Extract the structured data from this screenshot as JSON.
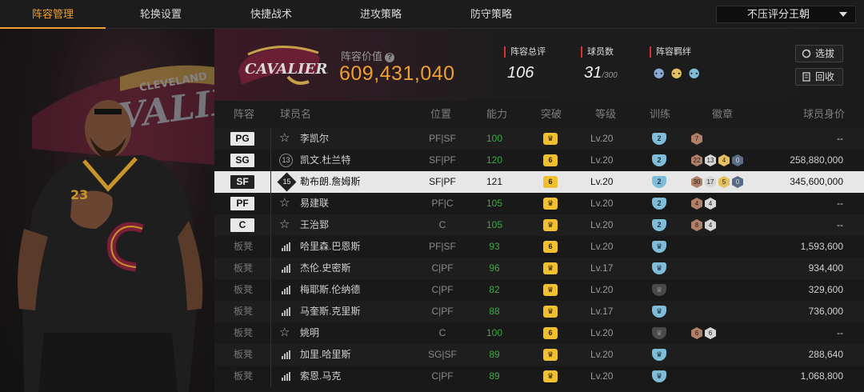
{
  "nav": {
    "tabs": [
      "阵容管理",
      "轮换设置",
      "快捷战术",
      "进攻策略",
      "防守策略"
    ],
    "active_tab": 0,
    "season_select": "不压评分王朝"
  },
  "header": {
    "team_logo_text": "CAVALIERS",
    "value_label": "阵容价值",
    "value": "609,431,040",
    "overall_label": "阵容总评",
    "overall": "106",
    "players_label": "球员数",
    "players_count": "31",
    "players_max": "/300",
    "bonds_label": "阵容羁绊",
    "select_button": "选拔",
    "recycle_button": "回收"
  },
  "columns": [
    "阵容",
    "球员名",
    "位置",
    "能力",
    "突破",
    "等级",
    "训练",
    "徽章",
    "球员身价"
  ],
  "rows": [
    {
      "slot": "PG",
      "starter": true,
      "icon": "star",
      "jersey": "",
      "name": "李凯尔",
      "position": "PF|SF",
      "ability": "100",
      "break": "",
      "level": "Lv.20",
      "train": "2",
      "train_dim": false,
      "badges": [
        {
          "t": "b-bronze",
          "v": "7"
        }
      ],
      "price": "--"
    },
    {
      "slot": "SG",
      "starter": true,
      "icon": "jersey",
      "jersey": "13",
      "name": "凯文.杜兰特",
      "position": "SF|PF",
      "ability": "120",
      "break": "6",
      "level": "Lv.20",
      "train": "2",
      "train_dim": false,
      "badges": [
        {
          "t": "b-bronze",
          "v": "22"
        },
        {
          "t": "b-silver",
          "v": "13"
        },
        {
          "t": "b-gold",
          "v": "4"
        },
        {
          "t": "b-blue",
          "v": "0"
        }
      ],
      "price": "258,880,000"
    },
    {
      "slot": "SF",
      "starter": true,
      "icon": "diamond",
      "jersey": "15",
      "name": "勒布朗.詹姆斯",
      "position": "SF|PF",
      "ability": "121",
      "break": "6",
      "level": "Lv.20",
      "train": "2",
      "train_dim": false,
      "badges": [
        {
          "t": "b-bronze",
          "v": "30"
        },
        {
          "t": "b-silver",
          "v": "17"
        },
        {
          "t": "b-gold",
          "v": "5"
        },
        {
          "t": "b-blue",
          "v": "0"
        }
      ],
      "price": "345,600,000",
      "selected": true
    },
    {
      "slot": "PF",
      "starter": true,
      "icon": "star",
      "jersey": "",
      "name": "易建联",
      "position": "PF|C",
      "ability": "105",
      "break": "",
      "level": "Lv.20",
      "train": "2",
      "train_dim": false,
      "badges": [
        {
          "t": "b-bronze",
          "v": "4"
        },
        {
          "t": "b-silver",
          "v": "4"
        }
      ],
      "price": "--"
    },
    {
      "slot": "C",
      "starter": true,
      "icon": "star",
      "jersey": "",
      "name": "王治郅",
      "position": "C",
      "ability": "105",
      "break": "",
      "level": "Lv.20",
      "train": "2",
      "train_dim": false,
      "badges": [
        {
          "t": "b-bronze",
          "v": "8"
        },
        {
          "t": "b-silver",
          "v": "4"
        }
      ],
      "price": "--"
    },
    {
      "slot": "板凳",
      "starter": false,
      "icon": "bars",
      "jersey": "",
      "name": "哈里森.巴恩斯",
      "position": "PF|SF",
      "ability": "93",
      "break": "6",
      "level": "Lv.20",
      "train": "",
      "train_dim": false,
      "badges": [],
      "price": "1,593,600"
    },
    {
      "slot": "板凳",
      "starter": false,
      "icon": "bars",
      "jersey": "",
      "name": "杰伦.史密斯",
      "position": "C|PF",
      "ability": "96",
      "break": "",
      "level": "Lv.17",
      "train": "",
      "train_dim": false,
      "badges": [],
      "price": "934,400"
    },
    {
      "slot": "板凳",
      "starter": false,
      "icon": "bars",
      "jersey": "",
      "name": "梅耶斯.伦纳德",
      "position": "C|PF",
      "ability": "82",
      "break": "",
      "level": "Lv.20",
      "train": "",
      "train_dim": true,
      "badges": [],
      "price": "329,600"
    },
    {
      "slot": "板凳",
      "starter": false,
      "icon": "bars",
      "jersey": "",
      "name": "马奎斯.克里斯",
      "position": "C|PF",
      "ability": "88",
      "break": "",
      "level": "Lv.17",
      "train": "",
      "train_dim": false,
      "badges": [],
      "price": "736,000"
    },
    {
      "slot": "板凳",
      "starter": false,
      "icon": "star",
      "jersey": "",
      "name": "姚明",
      "position": "C",
      "ability": "100",
      "break": "6",
      "level": "Lv.20",
      "train": "",
      "train_dim": true,
      "badges": [
        {
          "t": "b-bronze",
          "v": "6"
        },
        {
          "t": "b-silver",
          "v": "6"
        }
      ],
      "price": "--"
    },
    {
      "slot": "板凳",
      "starter": false,
      "icon": "bars",
      "jersey": "",
      "name": "加里.哈里斯",
      "position": "SG|SF",
      "ability": "89",
      "break": "",
      "level": "Lv.20",
      "train": "",
      "train_dim": false,
      "badges": [],
      "price": "288,640"
    },
    {
      "slot": "板凳",
      "starter": false,
      "icon": "bars",
      "jersey": "",
      "name": "索恩.马克",
      "position": "C|PF",
      "ability": "89",
      "break": "",
      "level": "Lv.20",
      "train": "",
      "train_dim": false,
      "badges": [],
      "price": "1,068,800"
    }
  ],
  "colors": {
    "accent": "#f0a030",
    "ability_green": "#3fa845",
    "stat_red": "#d93030"
  }
}
